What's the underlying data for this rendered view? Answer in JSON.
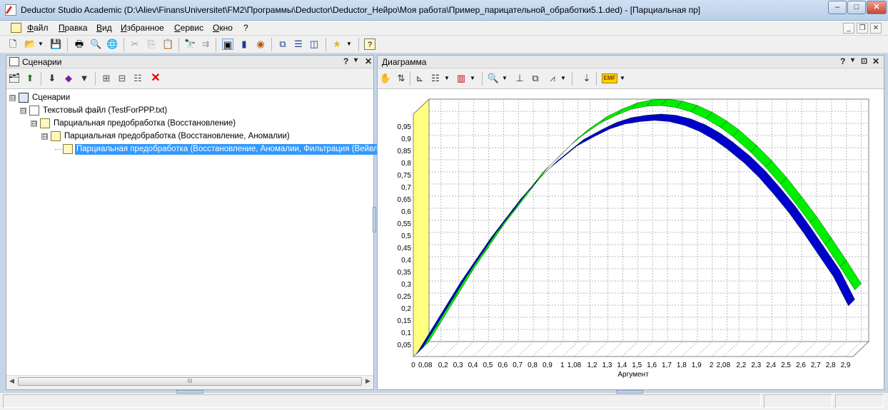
{
  "window": {
    "title": "Deductor Studio Academic (D:\\Aliev\\FinansUniversitet\\FM2\\Программы\\Deductor\\Deductor_Нейро\\Моя работа\\Пример_парицательной_обработки5.1.ded) - [Парциальная пр]",
    "minimize": "–",
    "maximize": "□",
    "close": "✕"
  },
  "menu": {
    "items": [
      "Файл",
      "Правка",
      "Вид",
      "Избранное",
      "Сервис",
      "Окно",
      "?"
    ],
    "mdi_minimize": "_",
    "mdi_restore": "❐",
    "mdi_close": "✕"
  },
  "toolbar": {
    "icons": [
      "new-file",
      "open-folder",
      "dropdown-arrow",
      "save",
      "print",
      "print-preview",
      "web",
      "cut",
      "copy",
      "paste",
      "find",
      "find-next",
      "scenario-view",
      "book",
      "wizard",
      "panels-tile",
      "panels-horizontal",
      "panels-vertical",
      "favorites-star",
      "dropdown-arrow",
      "help"
    ]
  },
  "left_panel": {
    "title": "Сценарии",
    "controls": [
      "?",
      "▾",
      "✕"
    ],
    "toolbar_icons": [
      "properties",
      "export",
      "import",
      "cube",
      "report",
      "tree-expand",
      "tree-collapse",
      "tree-sort",
      "delete"
    ],
    "tree": [
      {
        "label": "Сценарии",
        "level": 0,
        "expand": "⊟",
        "icon": "scenario-icon",
        "selected": false
      },
      {
        "label": "Текстовый файл (TestForPPP.txt)",
        "level": 1,
        "expand": "⊟",
        "icon": "text-file-icon",
        "selected": false
      },
      {
        "label": "Парциальная предобработка (Восстановление)",
        "level": 2,
        "expand": "⊟",
        "icon": "preprocessing-icon",
        "selected": false
      },
      {
        "label": "Парциальная предобработка (Восстановление, Аномалии)",
        "level": 3,
        "expand": "⊟",
        "icon": "preprocessing-icon",
        "selected": false
      },
      {
        "label": "Парциальная предобработка (Восстановление, Аномалии, Фильтрация (Вейвлет",
        "level": 4,
        "expand": "",
        "icon": "preprocessing-icon",
        "selected": true
      }
    ],
    "scroll_thumb_grip": "III"
  },
  "right_panel": {
    "title": "Диаграмма",
    "controls": [
      "?",
      "▾",
      "⊡",
      "✕"
    ],
    "toolbar_icons": [
      "hand-move",
      "series",
      "axes",
      "legend",
      "dropdown-arrow",
      "chart-type",
      "dropdown-arrow",
      "zoom",
      "dropdown-arrow",
      "zoom-fit",
      "copy-chart",
      "chart-wizard",
      "dropdown-arrow",
      "export-emf",
      "emf",
      "dropdown-arrow"
    ]
  },
  "chart_data": {
    "type": "line",
    "view": "3d",
    "xlabel": "Аргумент",
    "ylabel": "",
    "title": "",
    "ylim": [
      0,
      1
    ],
    "grid": true,
    "legend": "none",
    "x_tick_labels": [
      "0",
      "0,08",
      "0,2",
      "0,3",
      "0,4",
      "0,5",
      "0,6",
      "0,7",
      "0,8",
      "0,9",
      "1",
      "1,08",
      "1,2",
      "1,3",
      "1,4",
      "1,5",
      "1,6",
      "1,7",
      "1,8",
      "1,9",
      "2",
      "2,08",
      "2,2",
      "2,3",
      "2,4",
      "2,5",
      "2,6",
      "2,7",
      "2,8",
      "2,9"
    ],
    "y_tick_labels": [
      "0,05",
      "0,1",
      "0,15",
      "0,2",
      "0,25",
      "0,3",
      "0,35",
      "0,4",
      "0,45",
      "0,5",
      "0,55",
      "0,6",
      "0,65",
      "0,7",
      "0,75",
      "0,8",
      "0,85",
      "0,9",
      "0,95"
    ],
    "x": [
      0,
      0.08,
      0.2,
      0.3,
      0.4,
      0.5,
      0.6,
      0.7,
      0.8,
      0.9,
      1,
      1.08,
      1.2,
      1.3,
      1.4,
      1.5,
      1.6,
      1.7,
      1.8,
      1.9,
      2,
      2.08,
      2.2,
      2.3,
      2.4,
      2.5,
      2.6,
      2.7,
      2.8,
      2.9
    ],
    "series": [
      {
        "color": "#00ee00",
        "values": [
          0.0,
          0.08,
          0.2,
          0.3,
          0.39,
          0.48,
          0.56,
          0.64,
          0.72,
          0.78,
          0.84,
          0.88,
          0.93,
          0.96,
          0.985,
          0.997,
          1.0,
          0.992,
          0.974,
          0.946,
          0.909,
          0.873,
          0.808,
          0.746,
          0.676,
          0.598,
          0.516,
          0.427,
          0.335,
          0.239
        ]
      },
      {
        "color": "#0000cc",
        "values": [
          0.0,
          0.08,
          0.2,
          0.3,
          0.39,
          0.48,
          0.56,
          0.64,
          0.71,
          0.77,
          0.82,
          0.86,
          0.9,
          0.93,
          0.95,
          0.96,
          0.965,
          0.96,
          0.945,
          0.92,
          0.885,
          0.85,
          0.79,
          0.73,
          0.66,
          0.585,
          0.5,
          0.41,
          0.32,
          0.2
        ]
      }
    ],
    "colors": {
      "wall": "#ffff80",
      "grid": "#b8b8b8",
      "floor": "#ffffff"
    }
  },
  "status": {
    "cells": [
      "",
      "",
      ""
    ]
  }
}
